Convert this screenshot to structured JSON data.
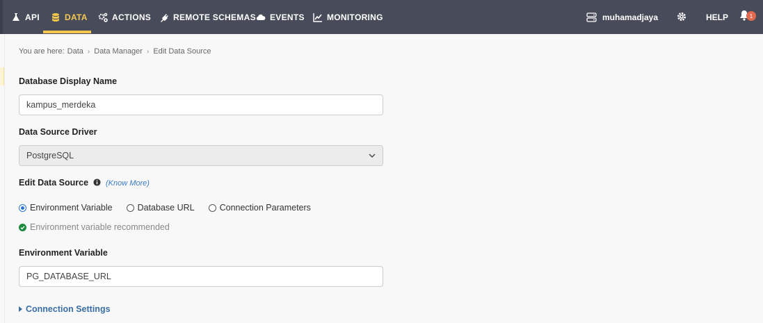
{
  "nav": {
    "items": [
      {
        "label": "API",
        "icon": "flask-icon"
      },
      {
        "label": "DATA",
        "icon": "database-icon"
      },
      {
        "label": "ACTIONS",
        "icon": "cogs-icon"
      },
      {
        "label": "REMOTE SCHEMAS",
        "icon": "plug-icon"
      },
      {
        "label": "EVENTS",
        "icon": "cloud-icon"
      },
      {
        "label": "MONITORING",
        "icon": "chart-line-icon"
      }
    ],
    "active": "DATA",
    "username": "muhamadjaya",
    "help_label": "HELP",
    "notification_count": "1"
  },
  "breadcrumb": {
    "prefix": "You are here:",
    "items": [
      "Data",
      "Data Manager",
      "Edit Data Source"
    ]
  },
  "form": {
    "display_name_label": "Database Display Name",
    "display_name_value": "kampus_merdeka",
    "driver_label": "Data Source Driver",
    "driver_value": "PostgreSQL",
    "edit_source_label": "Edit Data Source",
    "know_more": "(Know More)",
    "options": [
      "Environment Variable",
      "Database URL",
      "Connection Parameters"
    ],
    "selected_option": "Environment Variable",
    "recommend_text": "Environment variable recommended",
    "env_var_label": "Environment Variable",
    "env_var_value": "PG_DATABASE_URL",
    "connection_settings": "Connection Settings"
  },
  "colors": {
    "nav_bg": "#484c5a",
    "accent": "#f4c84e",
    "link": "#3a6ea5",
    "success": "#1e8a3e"
  }
}
